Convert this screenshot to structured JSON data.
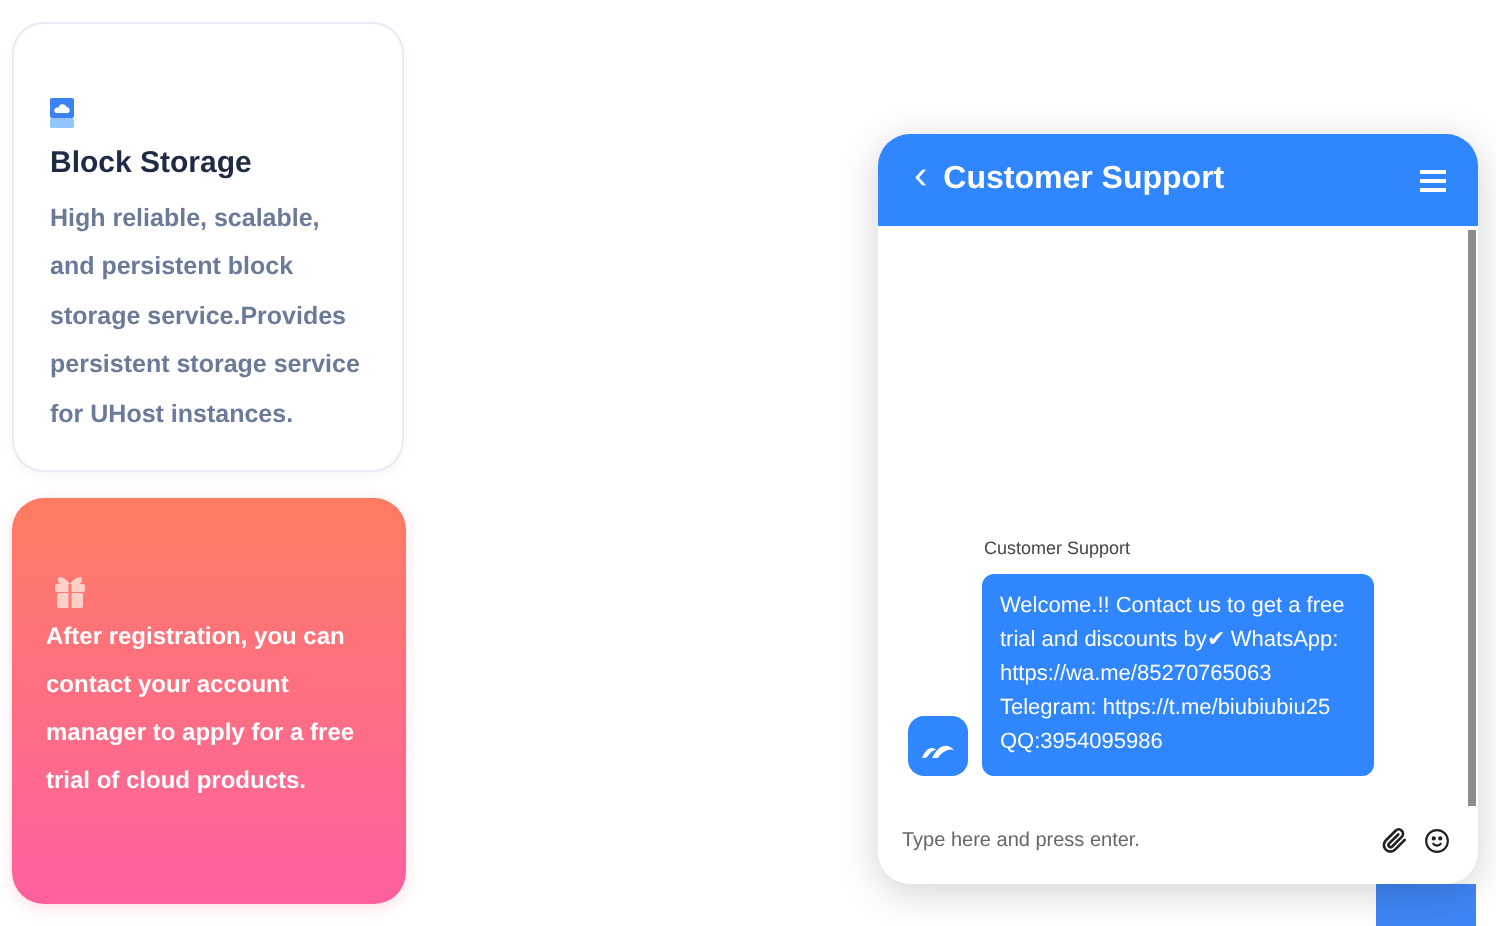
{
  "cards": [
    {
      "kind": "plain",
      "title": "Block Storage",
      "text": "High reliable, scalable, and persistent block storage service.Provides persistent storage service for UHost instances."
    },
    {
      "kind": "promo",
      "text": "After registration, you can contact your account manager to apply for a free trial of cloud products."
    }
  ],
  "chat": {
    "title": "Customer Support",
    "back": "‹",
    "messages": [
      {
        "sender": "Customer Support",
        "lines": [
          "Welcome.!! Contact us to get a free trial and discounts by✔ WhatsApp:",
          "https://wa.me/85270765063",
          "Telegram: https://t.me/biubiubiu25",
          "QQ:3954095986"
        ]
      }
    ],
    "input": {
      "placeholder": "Type here and press enter."
    }
  }
}
